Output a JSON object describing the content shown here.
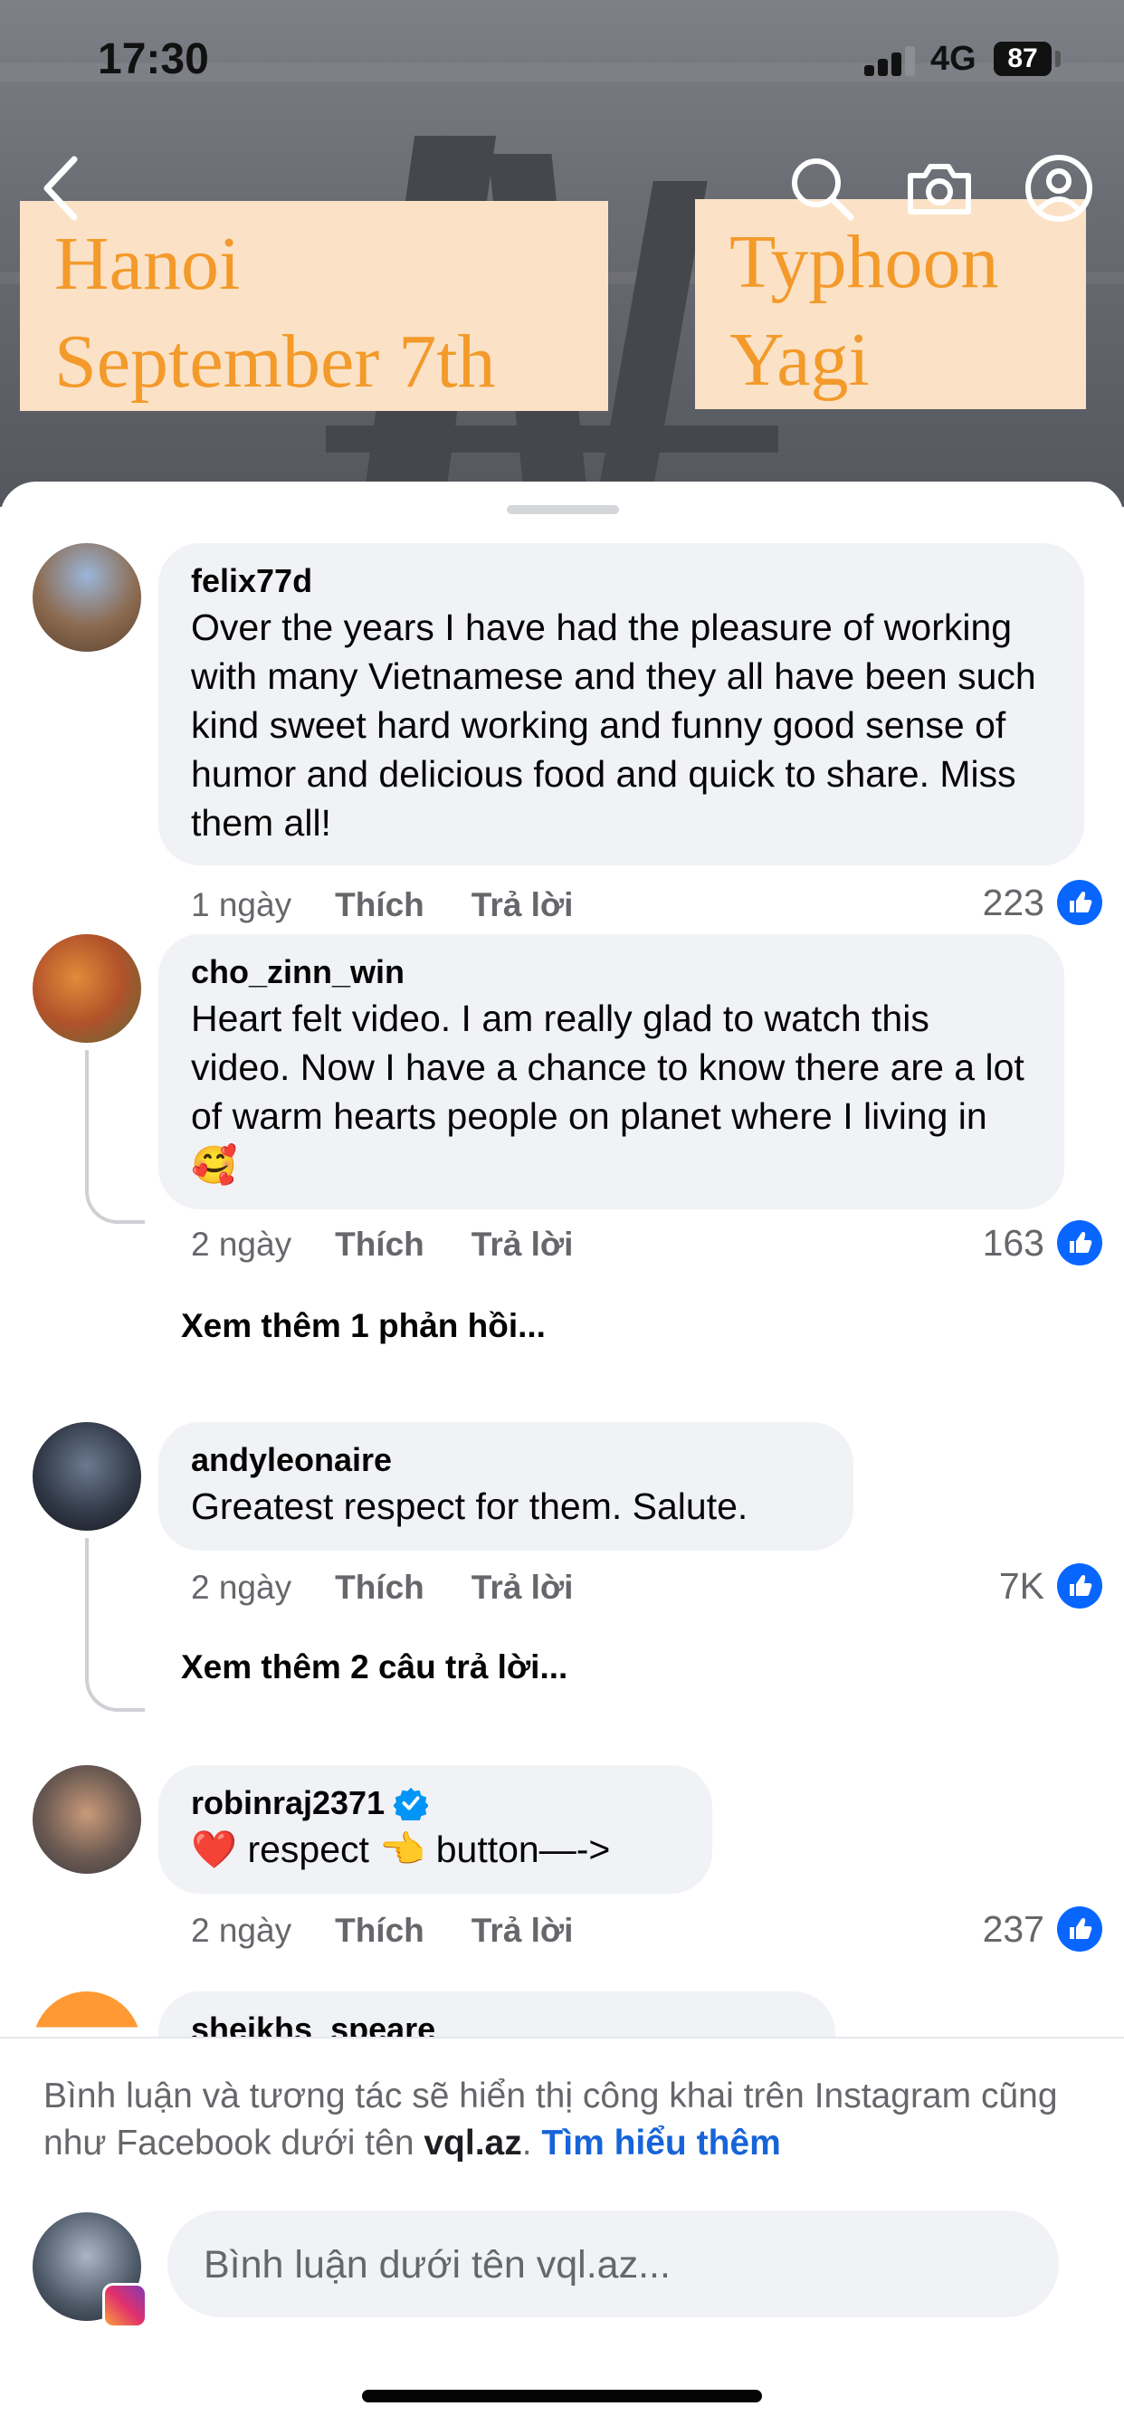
{
  "status_bar": {
    "time": "17:30",
    "network": "4G",
    "battery": "87"
  },
  "video": {
    "caption_left": [
      "Hanoi",
      "September 7th"
    ],
    "caption_right": [
      "Typhoon",
      "Yagi"
    ]
  },
  "comments": [
    {
      "author": "felix77d",
      "text": "Over the years I have had the pleasure of working with many Vietnamese and they all have been such kind sweet hard working and funny good sense of humor and delicious food and quick to share. Miss them all!",
      "time": "1 ngày",
      "like_label": "Thích",
      "reply_label": "Trả lời",
      "likes": "223"
    },
    {
      "author": "cho_zinn_win",
      "text": "Heart felt video. I am really glad to watch this video. Now I have a chance to know there are a lot of warm hearts people on planet where I living in 🥰",
      "time": "2 ngày",
      "like_label": "Thích",
      "reply_label": "Trả lời",
      "likes": "163",
      "more_replies": "Xem thêm 1 phản hồi..."
    },
    {
      "author": "andyleonaire",
      "text": "Greatest respect for them. Salute.",
      "time": "2 ngày",
      "like_label": "Thích",
      "reply_label": "Trả lời",
      "likes": "7K",
      "more_replies": "Xem thêm 2 câu trả lời..."
    },
    {
      "author": "robinraj2371",
      "verified": true,
      "text": "❤️ respect 👈 button—->",
      "time": "2 ngày",
      "like_label": "Thích",
      "reply_label": "Trả lời",
      "likes": "237"
    },
    {
      "author": "sheikhs_speare"
    }
  ],
  "footer": {
    "notice_prefix": "Bình luận và tương tác sẽ hiển thị công khai trên Instagram cũng như Facebook dưới tên ",
    "username": "vql.az",
    "notice_dot": ". ",
    "learn_more": "Tìm hiểu thêm",
    "input_placeholder": "Bình luận dưới tên vql.az..."
  },
  "colors": {
    "like_blue": "#0866ff",
    "link_blue": "#1664d8",
    "caption_orange": "#f39a2b",
    "caption_bg": "#fbe2c6"
  }
}
